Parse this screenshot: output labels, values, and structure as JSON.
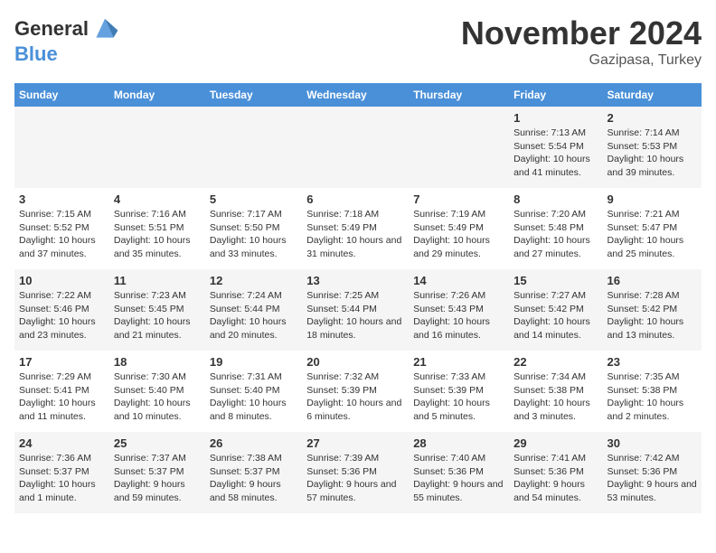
{
  "header": {
    "logo_line1": "General",
    "logo_line2": "Blue",
    "month": "November 2024",
    "location": "Gazipasa, Turkey"
  },
  "weekdays": [
    "Sunday",
    "Monday",
    "Tuesday",
    "Wednesday",
    "Thursday",
    "Friday",
    "Saturday"
  ],
  "weeks": [
    [
      {
        "day": "",
        "info": ""
      },
      {
        "day": "",
        "info": ""
      },
      {
        "day": "",
        "info": ""
      },
      {
        "day": "",
        "info": ""
      },
      {
        "day": "",
        "info": ""
      },
      {
        "day": "1",
        "info": "Sunrise: 7:13 AM\nSunset: 5:54 PM\nDaylight: 10 hours and 41 minutes."
      },
      {
        "day": "2",
        "info": "Sunrise: 7:14 AM\nSunset: 5:53 PM\nDaylight: 10 hours and 39 minutes."
      }
    ],
    [
      {
        "day": "3",
        "info": "Sunrise: 7:15 AM\nSunset: 5:52 PM\nDaylight: 10 hours and 37 minutes."
      },
      {
        "day": "4",
        "info": "Sunrise: 7:16 AM\nSunset: 5:51 PM\nDaylight: 10 hours and 35 minutes."
      },
      {
        "day": "5",
        "info": "Sunrise: 7:17 AM\nSunset: 5:50 PM\nDaylight: 10 hours and 33 minutes."
      },
      {
        "day": "6",
        "info": "Sunrise: 7:18 AM\nSunset: 5:49 PM\nDaylight: 10 hours and 31 minutes."
      },
      {
        "day": "7",
        "info": "Sunrise: 7:19 AM\nSunset: 5:49 PM\nDaylight: 10 hours and 29 minutes."
      },
      {
        "day": "8",
        "info": "Sunrise: 7:20 AM\nSunset: 5:48 PM\nDaylight: 10 hours and 27 minutes."
      },
      {
        "day": "9",
        "info": "Sunrise: 7:21 AM\nSunset: 5:47 PM\nDaylight: 10 hours and 25 minutes."
      }
    ],
    [
      {
        "day": "10",
        "info": "Sunrise: 7:22 AM\nSunset: 5:46 PM\nDaylight: 10 hours and 23 minutes."
      },
      {
        "day": "11",
        "info": "Sunrise: 7:23 AM\nSunset: 5:45 PM\nDaylight: 10 hours and 21 minutes."
      },
      {
        "day": "12",
        "info": "Sunrise: 7:24 AM\nSunset: 5:44 PM\nDaylight: 10 hours and 20 minutes."
      },
      {
        "day": "13",
        "info": "Sunrise: 7:25 AM\nSunset: 5:44 PM\nDaylight: 10 hours and 18 minutes."
      },
      {
        "day": "14",
        "info": "Sunrise: 7:26 AM\nSunset: 5:43 PM\nDaylight: 10 hours and 16 minutes."
      },
      {
        "day": "15",
        "info": "Sunrise: 7:27 AM\nSunset: 5:42 PM\nDaylight: 10 hours and 14 minutes."
      },
      {
        "day": "16",
        "info": "Sunrise: 7:28 AM\nSunset: 5:42 PM\nDaylight: 10 hours and 13 minutes."
      }
    ],
    [
      {
        "day": "17",
        "info": "Sunrise: 7:29 AM\nSunset: 5:41 PM\nDaylight: 10 hours and 11 minutes."
      },
      {
        "day": "18",
        "info": "Sunrise: 7:30 AM\nSunset: 5:40 PM\nDaylight: 10 hours and 10 minutes."
      },
      {
        "day": "19",
        "info": "Sunrise: 7:31 AM\nSunset: 5:40 PM\nDaylight: 10 hours and 8 minutes."
      },
      {
        "day": "20",
        "info": "Sunrise: 7:32 AM\nSunset: 5:39 PM\nDaylight: 10 hours and 6 minutes."
      },
      {
        "day": "21",
        "info": "Sunrise: 7:33 AM\nSunset: 5:39 PM\nDaylight: 10 hours and 5 minutes."
      },
      {
        "day": "22",
        "info": "Sunrise: 7:34 AM\nSunset: 5:38 PM\nDaylight: 10 hours and 3 minutes."
      },
      {
        "day": "23",
        "info": "Sunrise: 7:35 AM\nSunset: 5:38 PM\nDaylight: 10 hours and 2 minutes."
      }
    ],
    [
      {
        "day": "24",
        "info": "Sunrise: 7:36 AM\nSunset: 5:37 PM\nDaylight: 10 hours and 1 minute."
      },
      {
        "day": "25",
        "info": "Sunrise: 7:37 AM\nSunset: 5:37 PM\nDaylight: 9 hours and 59 minutes."
      },
      {
        "day": "26",
        "info": "Sunrise: 7:38 AM\nSunset: 5:37 PM\nDaylight: 9 hours and 58 minutes."
      },
      {
        "day": "27",
        "info": "Sunrise: 7:39 AM\nSunset: 5:36 PM\nDaylight: 9 hours and 57 minutes."
      },
      {
        "day": "28",
        "info": "Sunrise: 7:40 AM\nSunset: 5:36 PM\nDaylight: 9 hours and 55 minutes."
      },
      {
        "day": "29",
        "info": "Sunrise: 7:41 AM\nSunset: 5:36 PM\nDaylight: 9 hours and 54 minutes."
      },
      {
        "day": "30",
        "info": "Sunrise: 7:42 AM\nSunset: 5:36 PM\nDaylight: 9 hours and 53 minutes."
      }
    ]
  ]
}
